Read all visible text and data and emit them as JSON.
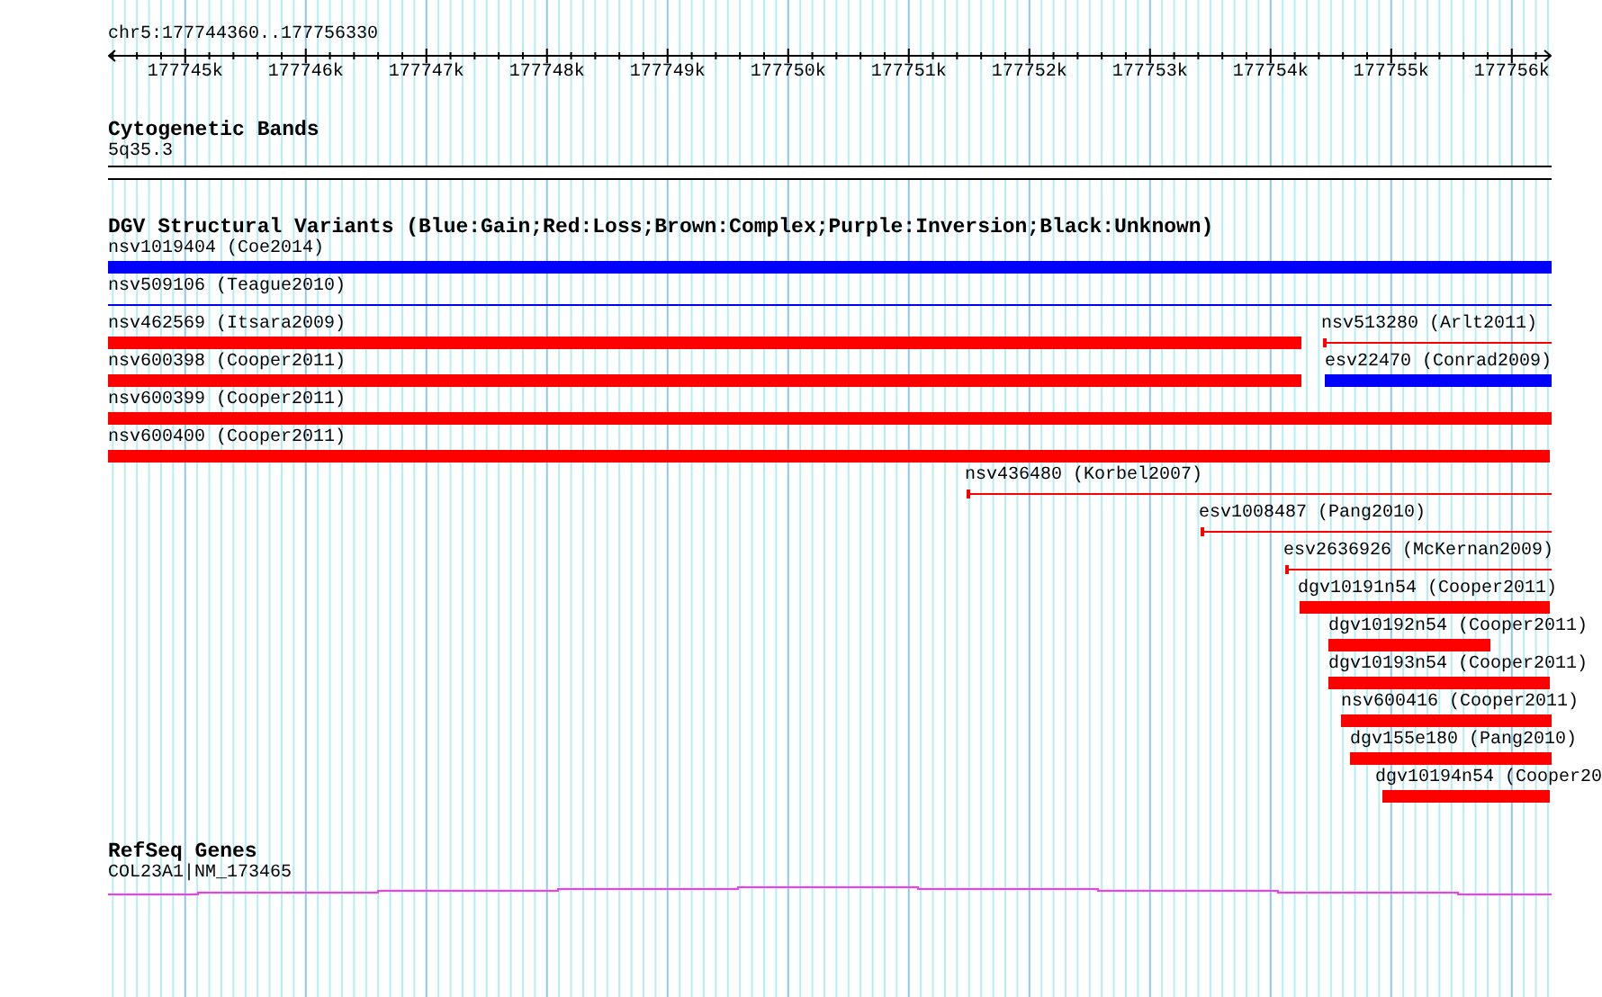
{
  "ruler": {
    "location": "chr5:177744360..177756330",
    "ticks": [
      "177745k",
      "177746k",
      "177747k",
      "177748k",
      "177749k",
      "177750k",
      "177751k",
      "177752k",
      "177753k",
      "177754k",
      "177755k",
      "177756k"
    ]
  },
  "cytogenetic_bands": {
    "title": "Cytogenetic Bands",
    "band": "5q35.3"
  },
  "dgv_structural_variants": {
    "title": "DGV Structural Variants (Blue:Gain;Red:Loss;Brown:Complex;Purple:Inversion;Black:Unknown)",
    "features": [
      {
        "label": "nsv1019404 (Coe2014)",
        "color": "#0000ff",
        "kind": "thick"
      },
      {
        "label": "nsv509106 (Teague2010)",
        "color": "#0000ff",
        "kind": "thin"
      },
      {
        "label": "nsv462569 (Itsara2009)",
        "color": "#ff0000",
        "kind": "thick"
      },
      {
        "label": "nsv513280 (Arlt2011)",
        "color": "#ff0000",
        "kind": "thin"
      },
      {
        "label": "nsv600398 (Cooper2011)",
        "color": "#ff0000",
        "kind": "thick"
      },
      {
        "label": "esv22470 (Conrad2009)",
        "color": "#0000ff",
        "kind": "thick"
      },
      {
        "label": "nsv600399 (Cooper2011)",
        "color": "#ff0000",
        "kind": "thick"
      },
      {
        "label": "nsv600400 (Cooper2011)",
        "color": "#ff0000",
        "kind": "thick"
      },
      {
        "label": "nsv436480 (Korbel2007)",
        "color": "#ff0000",
        "kind": "thin"
      },
      {
        "label": "esv1008487 (Pang2010)",
        "color": "#ff0000",
        "kind": "thin"
      },
      {
        "label": "esv2636926 (McKernan2009)",
        "color": "#ff0000",
        "kind": "thin"
      },
      {
        "label": "dgv10191n54 (Cooper2011)",
        "color": "#ff0000",
        "kind": "thick"
      },
      {
        "label": "dgv10192n54 (Cooper2011)",
        "color": "#ff0000",
        "kind": "thick"
      },
      {
        "label": "dgv10193n54 (Cooper2011)",
        "color": "#ff0000",
        "kind": "thick"
      },
      {
        "label": "nsv600416 (Cooper2011)",
        "color": "#ff0000",
        "kind": "thick"
      },
      {
        "label": "dgv155e180 (Pang2010)",
        "color": "#ff0000",
        "kind": "thick"
      },
      {
        "label": "dgv10194n54 (Cooper20",
        "color": "#ff0000",
        "kind": "thick"
      }
    ]
  },
  "refseq_genes": {
    "title": "RefSeq Genes",
    "gene": "COL23A1|NM_173465"
  }
}
